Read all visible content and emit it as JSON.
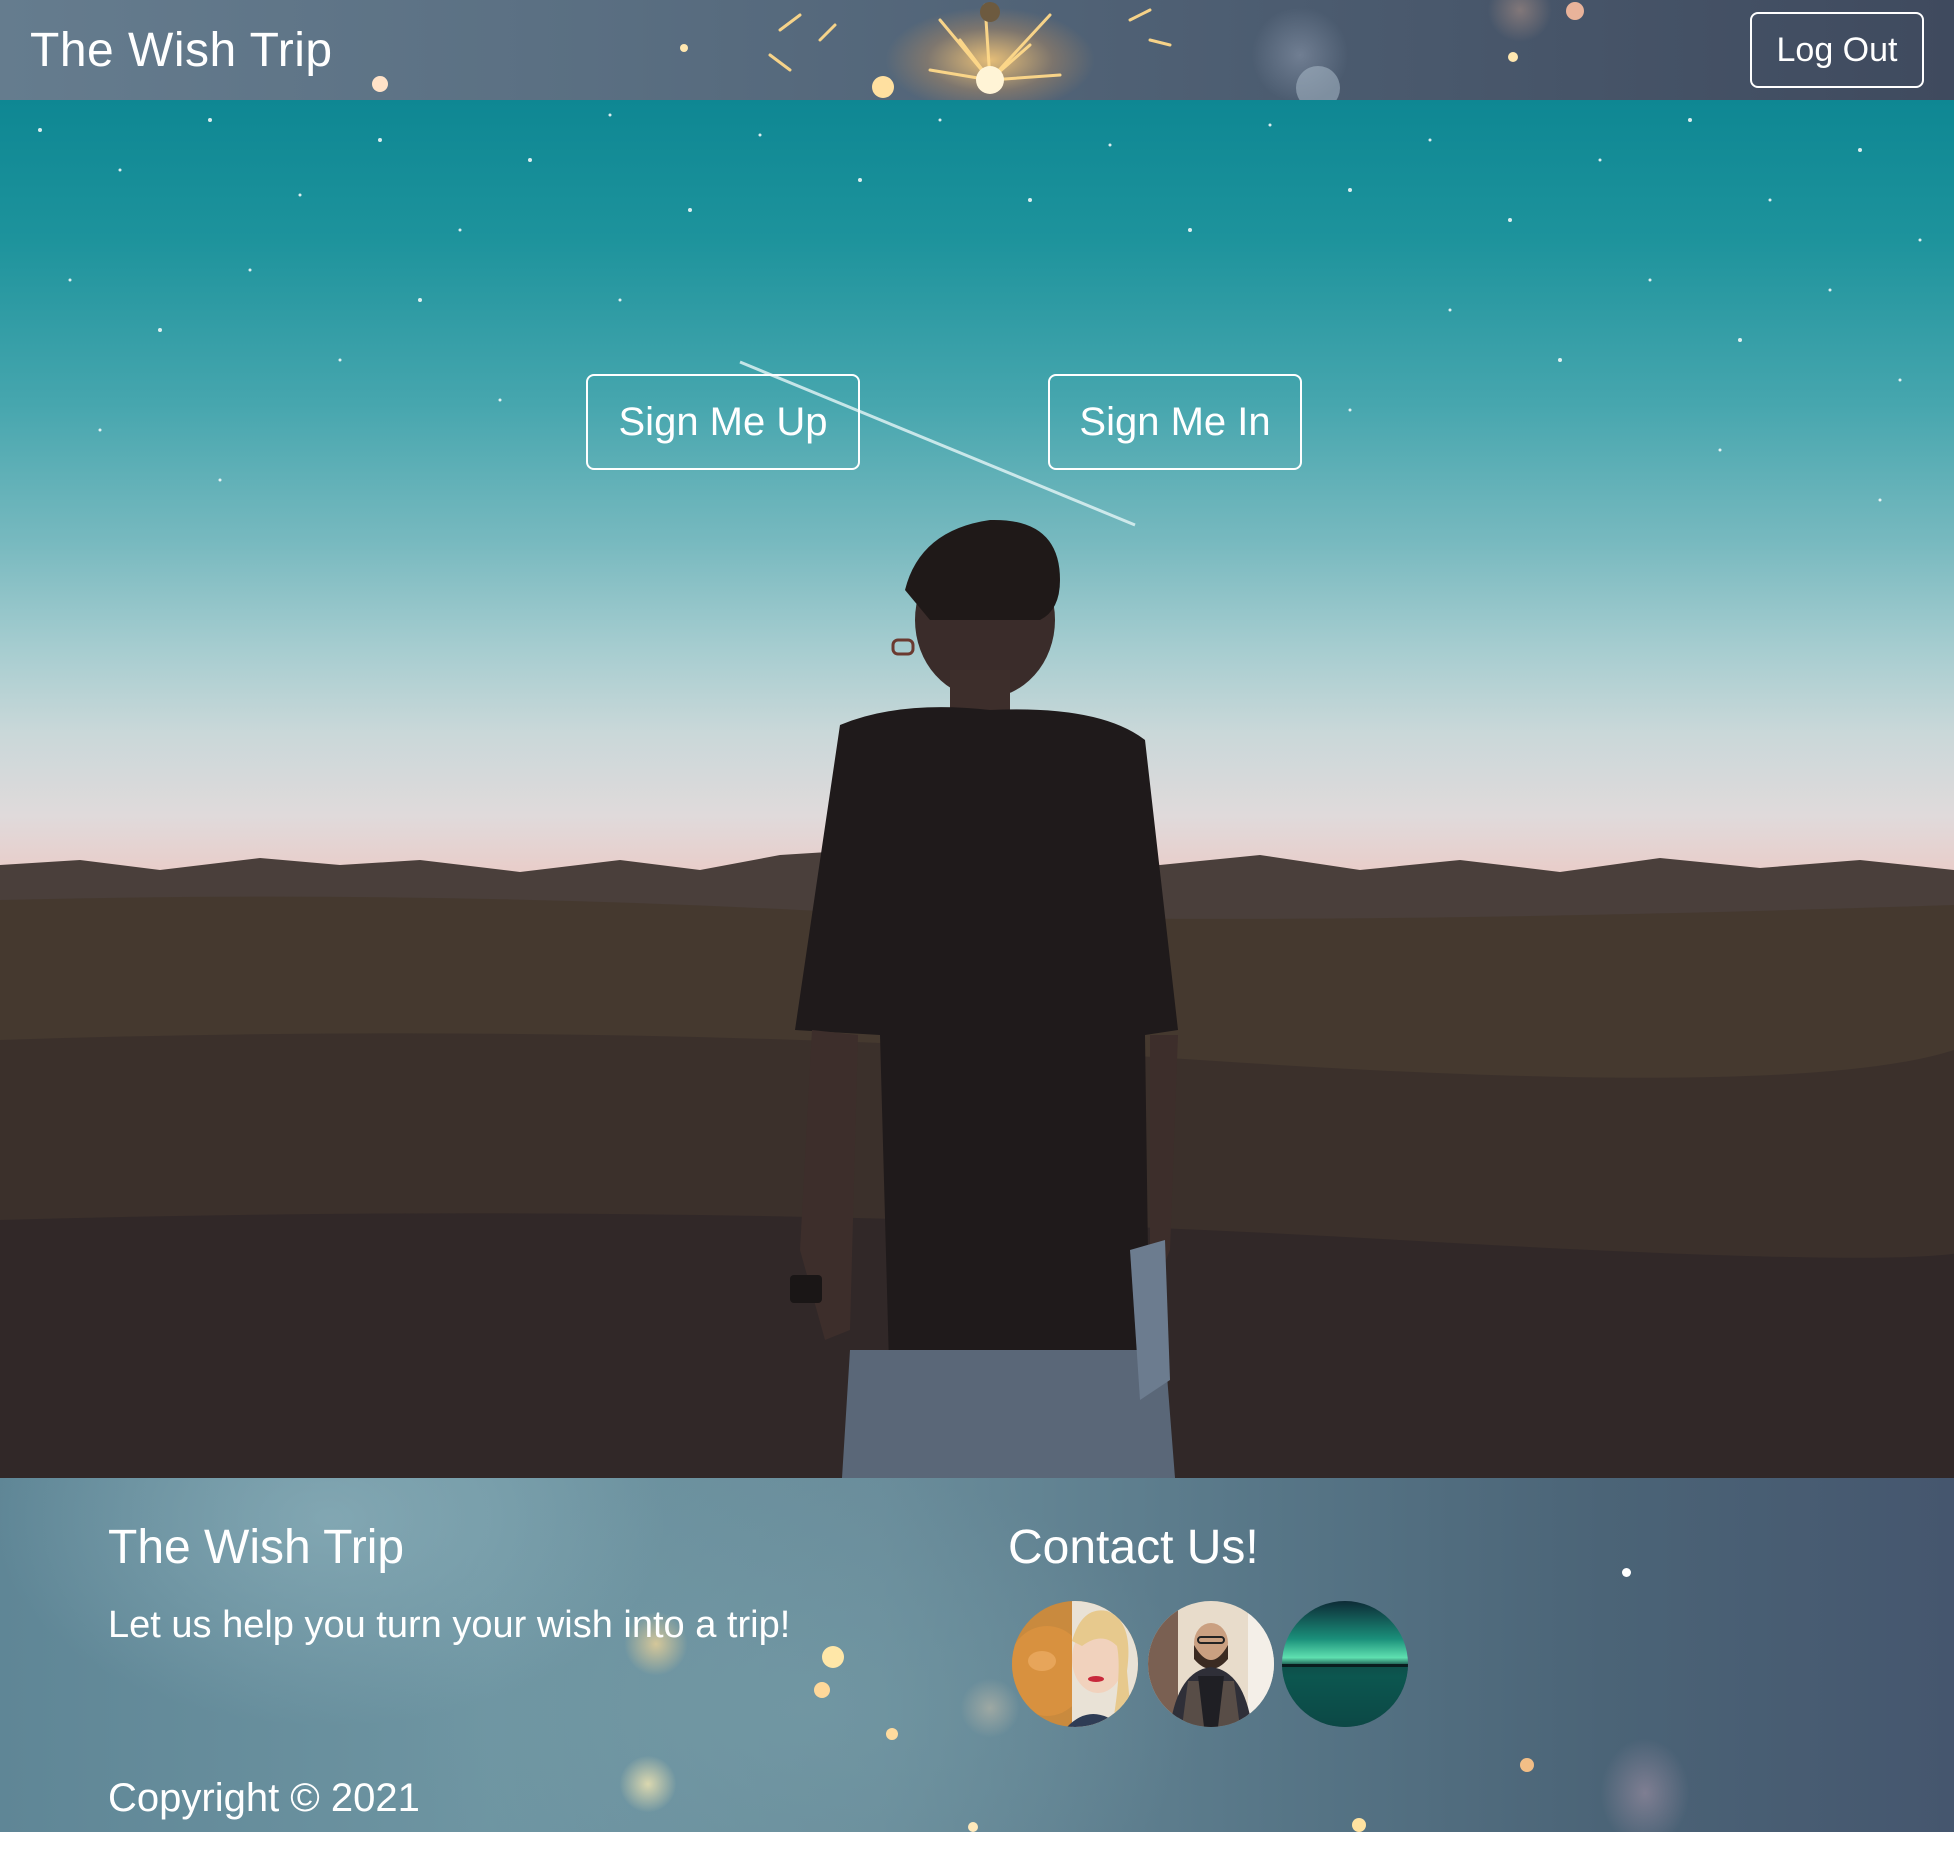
{
  "navbar": {
    "brand": "The Wish Trip",
    "logout_label": "Log Out"
  },
  "hero": {
    "signup_label": "Sign Me Up",
    "signin_label": "Sign Me In"
  },
  "footer": {
    "title": "The Wish Trip",
    "tagline": "Let us help you turn your wish into a trip!",
    "contact_title": "Contact Us!",
    "contacts": [
      {
        "avatar": "woman-with-cat-avatar"
      },
      {
        "avatar": "bearded-man-avatar"
      },
      {
        "avatar": "aurora-landscape-avatar"
      }
    ],
    "copyright": "Copyright © 2021"
  }
}
